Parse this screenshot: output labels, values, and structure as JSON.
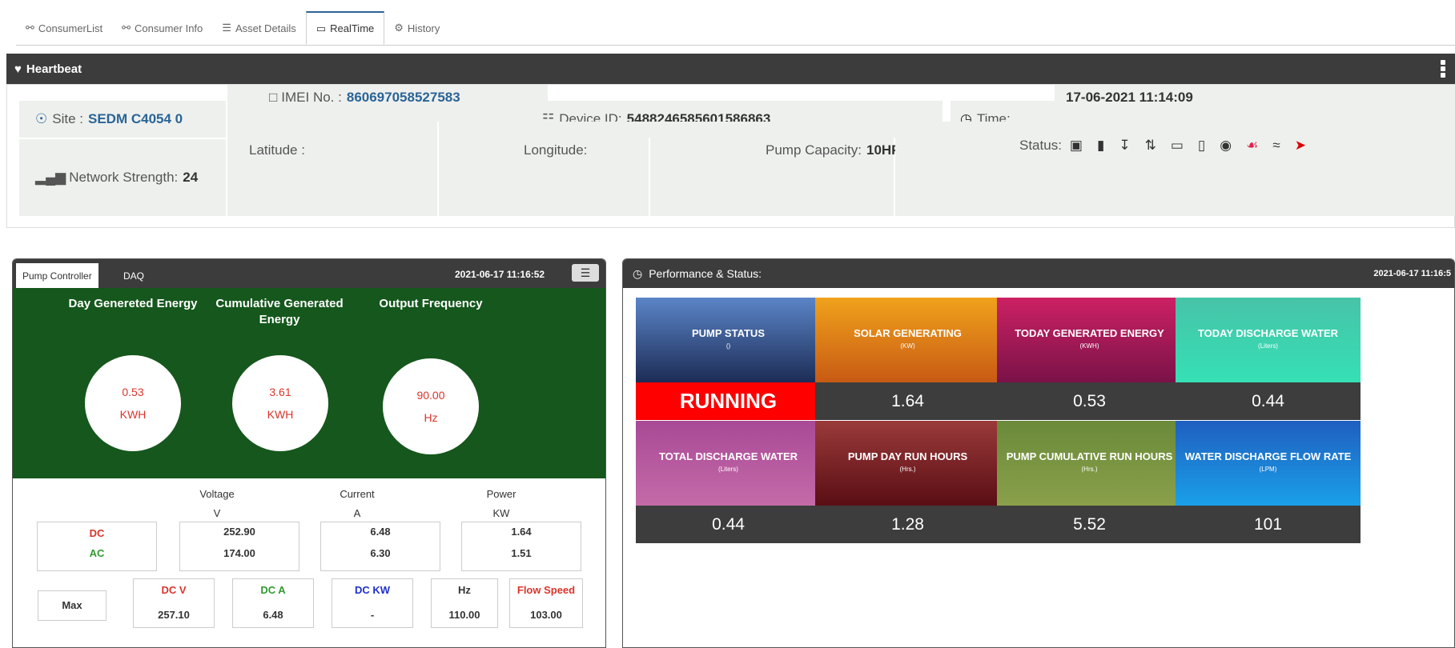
{
  "tabs": [
    {
      "label": "ConsumerList",
      "icon": "user-icon"
    },
    {
      "label": "Consumer Info",
      "icon": "user-icon"
    },
    {
      "label": "Asset Details",
      "icon": "list-icon"
    },
    {
      "label": "RealTime",
      "icon": "monitor-icon",
      "active": true
    },
    {
      "label": "History",
      "icon": "gear-icon"
    }
  ],
  "heartbeat": {
    "title": "Heartbeat",
    "site_label": "Site :",
    "site_value": "SEDM C4054 0",
    "imei_label": "IMEI No. :",
    "imei_value": "860697058527583",
    "device_label": "Device ID:",
    "device_value": "5488246585601586863",
    "time_label": "Time:",
    "time_value": "17-06-2021 11:14:09",
    "network_label": "Network Strength:",
    "network_value": "24",
    "latitude_label": "Latitude :",
    "longitude_label": "Longitude:",
    "pump_capacity_label": "Pump Capacity:",
    "pump_capacity_value": "10HP",
    "status_label": "Status:"
  },
  "left_panel": {
    "tab_pump": "Pump Controller",
    "tab_daq": "DAQ",
    "timestamp": "2021-06-17 11:16:52",
    "gauges": [
      {
        "label": "Day Genereted Energy",
        "value": "0.53",
        "unit": "KWH"
      },
      {
        "label": "Cumulative Generated Energy",
        "value": "3.61",
        "unit": "KWH"
      },
      {
        "label": "Output Frequency",
        "value": "90.00",
        "unit": "Hz"
      }
    ],
    "cols": {
      "voltage": "Voltage",
      "current": "Current",
      "power": "Power",
      "v": "V",
      "a": "A",
      "kw": "KW"
    },
    "dc_label": "DC",
    "ac_label": "AC",
    "dc": {
      "voltage": "252.90",
      "current": "6.48",
      "power": "1.64"
    },
    "ac": {
      "voltage": "174.00",
      "current": "6.30",
      "power": "1.51"
    },
    "max_label": "Max",
    "max_headers": {
      "dcv": "DC V",
      "dca": "DC A",
      "dckw": "DC KW",
      "hz": "Hz",
      "flow": "Flow Speed"
    },
    "max_values": {
      "dcv": "257.10",
      "dca": "6.48",
      "dckw": "-",
      "hz": "110.00",
      "flow": "103.00"
    }
  },
  "right_panel": {
    "title": "Performance & Status:",
    "timestamp": "2021-06-17 11:16:5",
    "cards": [
      {
        "title": "PUMP STATUS",
        "unit": "()",
        "value": "RUNNING",
        "color1": "#5b85c8",
        "color2": "#1c2c55"
      },
      {
        "title": "SOLAR GENERATING",
        "unit": "(KW)",
        "value": "1.64",
        "color1": "#f0a21c",
        "color2": "#c85a14"
      },
      {
        "title": "TODAY GENERATED ENERGY",
        "unit": "(KWH)",
        "value": "0.53",
        "color1": "#cc2164",
        "color2": "#7a1248"
      },
      {
        "title": "TODAY DISCHARGE WATER",
        "unit": "(Liters)",
        "value": "0.44",
        "color1": "#47c3a8",
        "color2": "#35e0b5"
      },
      {
        "title": "TOTAL DISCHARGE WATER",
        "unit": "(Liters)",
        "value": "0.44",
        "color1": "#a94a96",
        "color2": "#c46aa8"
      },
      {
        "title": "PUMP DAY RUN HOURS",
        "unit": "(Hrs.)",
        "value": "1.28",
        "color1": "#9a3a3a",
        "color2": "#5a0e14"
      },
      {
        "title": "PUMP CUMULATIVE RUN HOURS",
        "unit": "(Hrs.)",
        "value": "5.52",
        "color1": "#6a8a3a",
        "color2": "#8aa04a"
      },
      {
        "title": "WATER DISCHARGE FLOW RATE",
        "unit": "(LPM)",
        "value": "101",
        "color1": "#1f5fbf",
        "color2": "#1aa0e8"
      }
    ]
  },
  "colors": {
    "dark_header": "#3c3c3c",
    "panel_green": "#15571c",
    "dc_red": "#d9342b",
    "ac_green": "#2e9a2e",
    "running_red": "#ff0000"
  }
}
